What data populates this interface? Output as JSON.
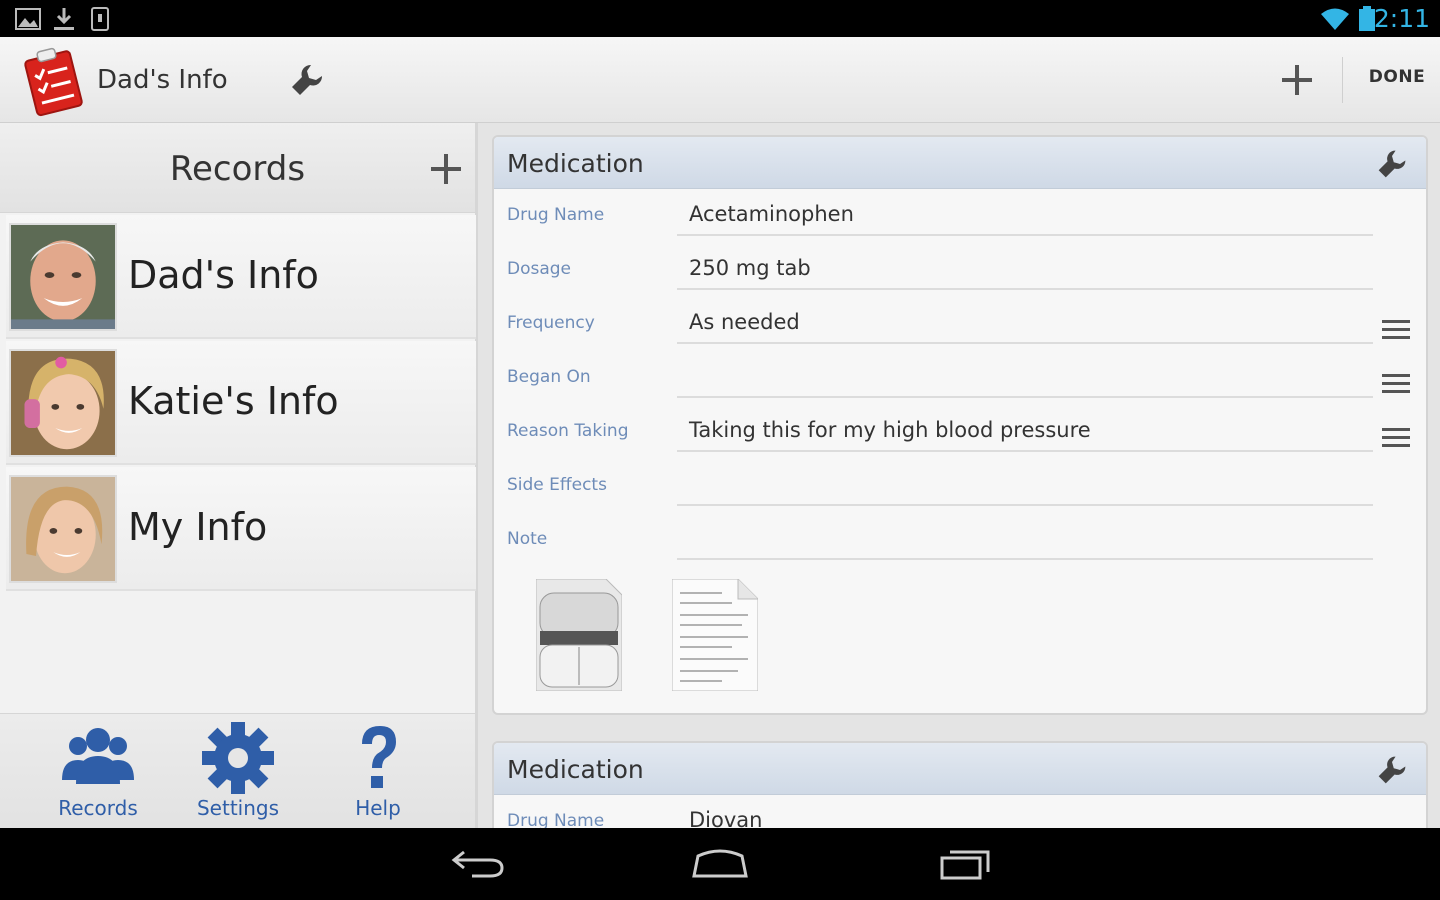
{
  "status_bar": {
    "time": "2:11",
    "left_icons": [
      "picture-icon",
      "download-icon",
      "phone-icon"
    ],
    "right_icons": [
      "wifi-icon",
      "battery-icon"
    ],
    "accent_color": "#33b5e5"
  },
  "action_bar": {
    "title": "Dad's Info",
    "done_label": "DONE"
  },
  "records": {
    "title": "Records",
    "items": [
      {
        "name": "Dad's Info"
      },
      {
        "name": "Katie's Info"
      },
      {
        "name": "My Info"
      }
    ]
  },
  "bottom_nav": {
    "items": [
      {
        "label": "Records",
        "icon": "people-icon"
      },
      {
        "label": "Settings",
        "icon": "gear-icon"
      },
      {
        "label": "Help",
        "icon": "question-icon"
      }
    ],
    "color": "#2f5ea8"
  },
  "cards": [
    {
      "title": "Medication",
      "fields": [
        {
          "label": "Drug Name",
          "value": ""
        },
        {
          "label": "Dosage",
          "value": "250 mg tab"
        },
        {
          "label": "Frequency",
          "value": "As needed"
        },
        {
          "label": "Began On",
          "value": ""
        },
        {
          "label": "Reason Taking",
          "value": "Taking this for my high blood pressure"
        },
        {
          "label": "Side Effects",
          "value": ""
        },
        {
          "label": "Note",
          "value": ""
        }
      ],
      "drug_name": "Acetaminophen"
    },
    {
      "title": "Medication",
      "fields": [
        {
          "label": "Drug Name",
          "value": "Diovan"
        }
      ]
    }
  ]
}
